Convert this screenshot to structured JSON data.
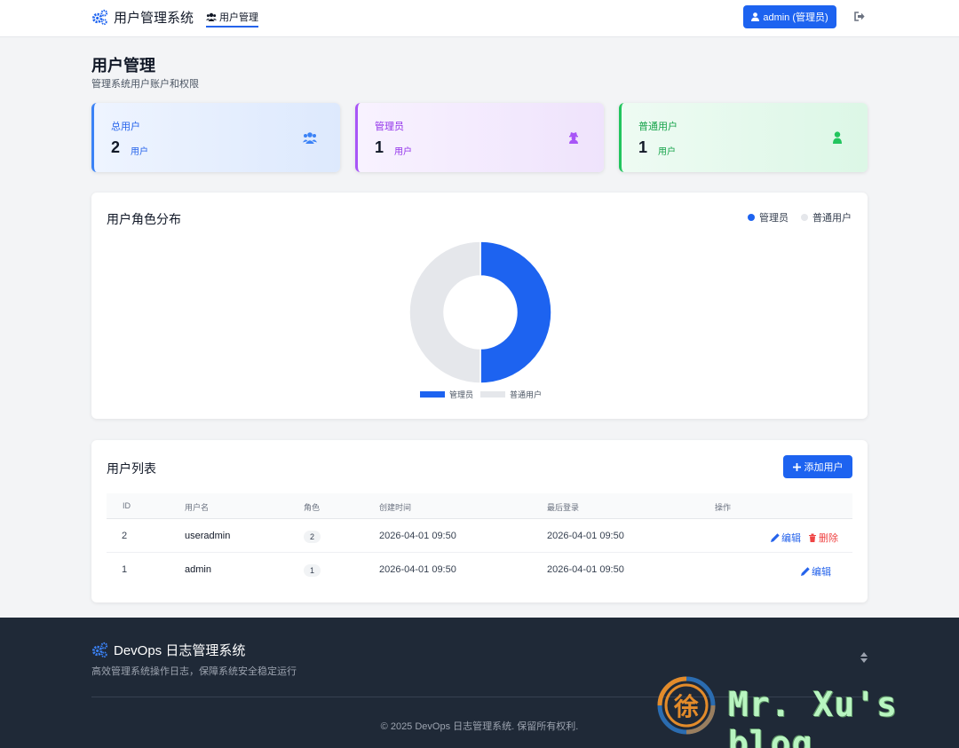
{
  "header": {
    "app_title": "用户管理系统",
    "nav_tab": "用户管理",
    "user_button": "admin (管理员)"
  },
  "page": {
    "title": "用户管理",
    "subtitle": "管理系统用户账户和权限"
  },
  "stats": [
    {
      "label": "总用户",
      "value": "2",
      "unit": "用户",
      "icon": "users-icon",
      "color": "#3b82f6"
    },
    {
      "label": "管理员",
      "value": "1",
      "unit": "用户",
      "icon": "user-secret-icon",
      "color": "#a855f7"
    },
    {
      "label": "普通用户",
      "value": "1",
      "unit": "用户",
      "icon": "user-icon",
      "color": "#22c55e"
    }
  ],
  "chart_card": {
    "title": "用户角色分布"
  },
  "chart_data": {
    "type": "pie",
    "categories": [
      "管理员",
      "普通用户"
    ],
    "values": [
      1,
      1
    ],
    "colors": [
      "#1d63f0",
      "#e5e7eb"
    ],
    "donut": true,
    "legend_top": [
      "管理员",
      "普通用户"
    ],
    "legend_bottom": [
      "管理员",
      "普通用户"
    ]
  },
  "table_card": {
    "title": "用户列表",
    "add_button": "添加用户",
    "columns": [
      "ID",
      "用户名",
      "角色",
      "创建时间",
      "最后登录",
      "操作"
    ],
    "rows": [
      {
        "id": "2",
        "username": "useradmin",
        "role": "2",
        "created": "2026-04-01 09:50",
        "last_login": "2026-04-01 09:50",
        "edit": "编辑",
        "delete": "删除"
      },
      {
        "id": "1",
        "username": "admin",
        "role": "1",
        "created": "2026-04-01 09:50",
        "last_login": "2026-04-01 09:50",
        "edit": "编辑"
      }
    ]
  },
  "footer": {
    "title": "DevOps 日志管理系统",
    "description": "高效管理系统操作日志，保障系统安全稳定运行",
    "copyright": "© 2025 DevOps 日志管理系统. 保留所有权利."
  },
  "watermark": {
    "logo_char": "徐",
    "text": "Mr. Xu's blog"
  },
  "colors": {
    "primary": "#1d63f0",
    "footer_bg": "#1f2937",
    "danger": "#ef4444"
  }
}
